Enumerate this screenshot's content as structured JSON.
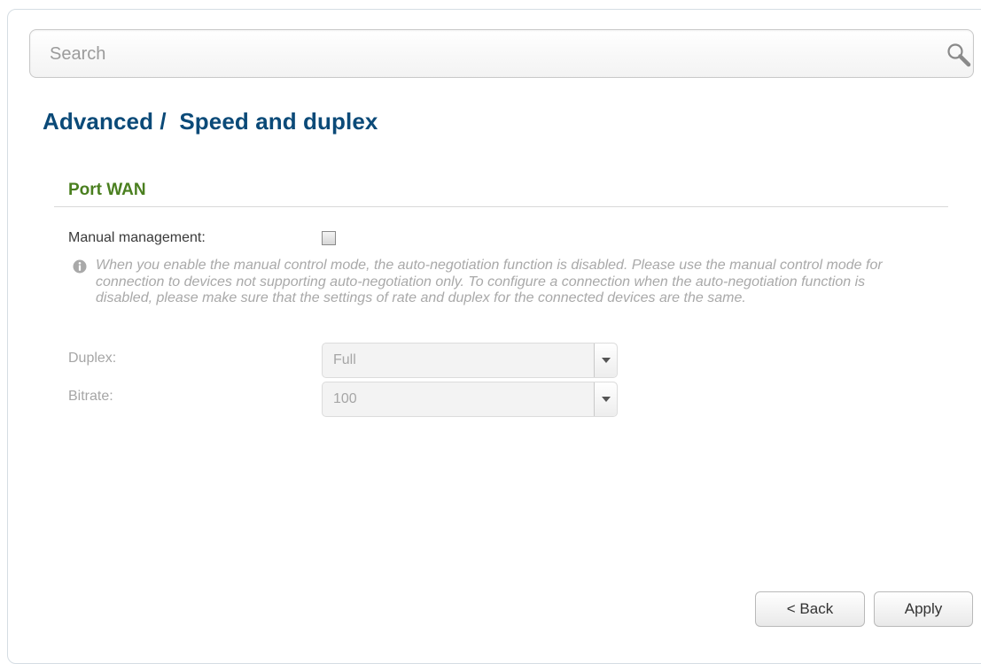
{
  "search": {
    "placeholder": "Search",
    "icon": "search-icon"
  },
  "page": {
    "title": "Advanced /  Speed and duplex"
  },
  "section": {
    "title": "Port WAN"
  },
  "manual_management": {
    "label": "Manual management:",
    "checked": false
  },
  "info": {
    "icon": "info-icon",
    "text": "When you enable the manual control mode, the auto-negotiation function is disabled. Please use the manual control mode for connection to devices not supporting auto-negotiation only. To configure a connection when the auto-negotiation function is disabled, please make sure that the settings of rate and duplex for the connected devices are the same."
  },
  "duplex": {
    "label": "Duplex:",
    "value": "Full"
  },
  "bitrate": {
    "label": "Bitrate:",
    "value": "100"
  },
  "buttons": {
    "back": "< Back",
    "apply": "Apply"
  },
  "colors": {
    "title": "#0b4a78",
    "section_title": "#4a7f1f",
    "disabled_text": "#a6a6a6"
  }
}
